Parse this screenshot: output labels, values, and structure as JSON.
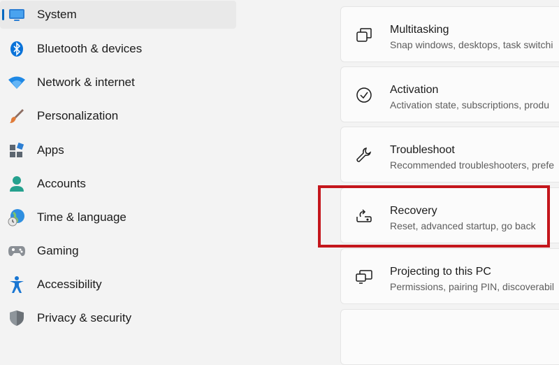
{
  "sidebar": {
    "items": [
      {
        "label": "System",
        "icon": "monitor-icon",
        "selected": true
      },
      {
        "label": "Bluetooth & devices",
        "icon": "bluetooth-icon"
      },
      {
        "label": "Network & internet",
        "icon": "wifi-icon"
      },
      {
        "label": "Personalization",
        "icon": "paintbrush-icon"
      },
      {
        "label": "Apps",
        "icon": "apps-icon"
      },
      {
        "label": "Accounts",
        "icon": "person-icon"
      },
      {
        "label": "Time & language",
        "icon": "globe-clock-icon"
      },
      {
        "label": "Gaming",
        "icon": "gamepad-icon"
      },
      {
        "label": "Accessibility",
        "icon": "accessibility-icon"
      },
      {
        "label": "Privacy & security",
        "icon": "shield-icon"
      }
    ]
  },
  "content": {
    "cards": [
      {
        "title": "Multitasking",
        "subtitle": "Snap windows, desktops, task switchi",
        "icon": "multitasking-icon"
      },
      {
        "title": "Activation",
        "subtitle": "Activation state, subscriptions, produ",
        "icon": "check-circle-icon"
      },
      {
        "title": "Troubleshoot",
        "subtitle": "Recommended troubleshooters, prefe",
        "icon": "wrench-icon"
      },
      {
        "title": "Recovery",
        "subtitle": "Reset, advanced startup, go back",
        "icon": "recovery-icon",
        "highlighted": true
      },
      {
        "title": "Projecting to this PC",
        "subtitle": "Permissions, pairing PIN, discoverabil",
        "icon": "projecting-icon"
      }
    ]
  },
  "colors": {
    "accent": "#0067c0",
    "highlight": "#c4161c"
  }
}
